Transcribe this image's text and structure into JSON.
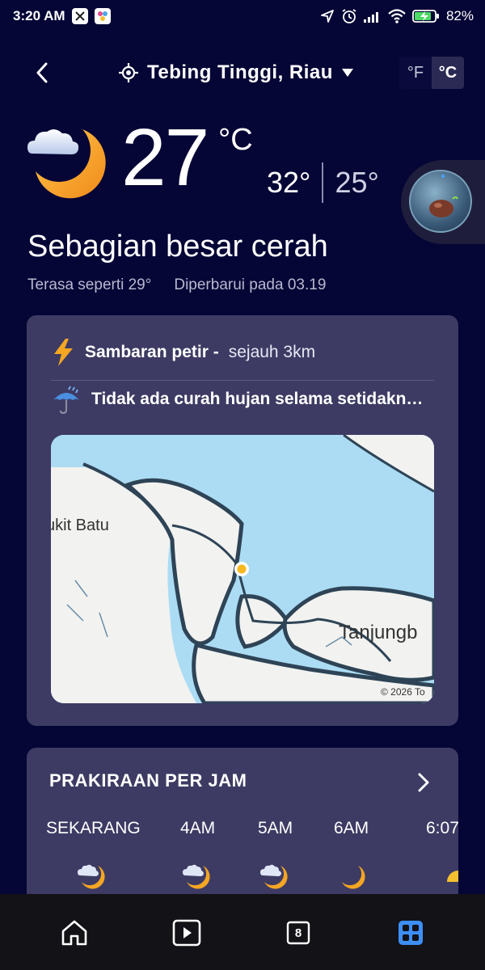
{
  "status_bar": {
    "time": "3:20 AM",
    "battery": "82%",
    "icons": [
      "navigation-arrow-icon",
      "alarm-icon",
      "signal-icon",
      "wifi-icon",
      "battery-charging-icon"
    ]
  },
  "header": {
    "location": "Tebing Tinggi, Riau",
    "unit_f": "°F",
    "unit_c": "°C",
    "selected_unit": "°C"
  },
  "current": {
    "temperature": "27",
    "unit": "°C",
    "high": "32°",
    "low": "25°",
    "condition": "Sebagian besar cerah",
    "feels_like": "Terasa seperti 29°",
    "updated": "Diperbarui pada 03.19",
    "icon": "partly-cloudy-night-icon"
  },
  "radar_card": {
    "lightning_title": "Sambaran petir -",
    "lightning_desc": "sejauh 3km",
    "rain_text": "Tidak ada curah hujan selama setidakn…",
    "map_labels": {
      "left": "ukit Batu",
      "right": "Tanjungb",
      "copyright": "© 2026 To"
    }
  },
  "hourly": {
    "title": "PRAKIRAAN PER JAM",
    "hours": [
      {
        "label": "SEKARANG",
        "icon": "partly-cloudy-night-icon"
      },
      {
        "label": "4AM",
        "icon": "partly-cloudy-night-icon"
      },
      {
        "label": "5AM",
        "icon": "partly-cloudy-night-icon"
      },
      {
        "label": "6AM",
        "icon": "moon-icon"
      },
      {
        "label": "6:07",
        "icon": "sunrise-icon"
      }
    ]
  },
  "bottom_nav": {
    "items": [
      {
        "name": "home",
        "icon": "home-icon"
      },
      {
        "name": "video",
        "icon": "play-icon"
      },
      {
        "name": "tabs",
        "icon": "tabs-icon",
        "count": "8"
      },
      {
        "name": "apps",
        "icon": "apps-grid-icon"
      }
    ]
  },
  "colors": {
    "background": "#050536",
    "card": "#3d3b63",
    "accent_blue": "#3d8ef5",
    "map_water": "#a8dcf2",
    "map_land": "#f2f2f0"
  }
}
